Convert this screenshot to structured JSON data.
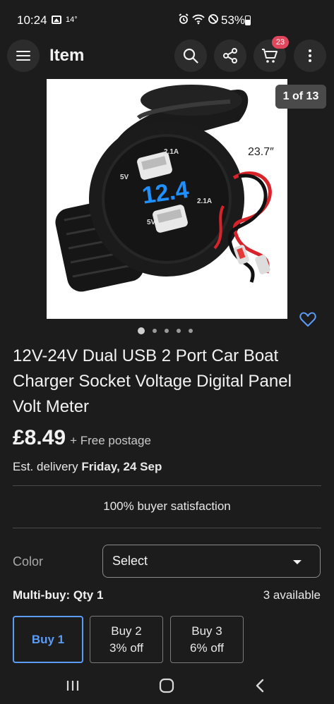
{
  "status_bar": {
    "time": "10:24",
    "temperature": "14°",
    "battery": "53%"
  },
  "app_bar": {
    "title": "Item",
    "cart_count": "23"
  },
  "gallery": {
    "counter": "1 of 13",
    "image_label": "23.7″",
    "display_reading": "12.4",
    "port_labels": [
      "5V",
      "2.1A",
      "5V",
      "2.1A"
    ],
    "dot_count": 5,
    "active_dot": 1
  },
  "item": {
    "title": "12V-24V Dual USB 2 Port Car Boat Charger Socket Voltage Digital Panel Volt Meter",
    "price": "£8.49",
    "postage": "+ Free postage",
    "delivery_prefix": "Est. delivery",
    "delivery_date": "Friday, 24 Sep",
    "satisfaction": "100% buyer satisfaction"
  },
  "color": {
    "label": "Color",
    "selected": "Select"
  },
  "multibuy": {
    "label": "Multi-buy: Qty 1",
    "available": "3 available",
    "options": [
      {
        "line1": "Buy 1",
        "line2": ""
      },
      {
        "line1": "Buy 2",
        "line2": "3% off"
      },
      {
        "line1": "Buy 3",
        "line2": "6% off"
      }
    ]
  },
  "colors": {
    "background": "#1c1c1c",
    "accent": "#5b9cf6",
    "badge": "#e0475c"
  }
}
